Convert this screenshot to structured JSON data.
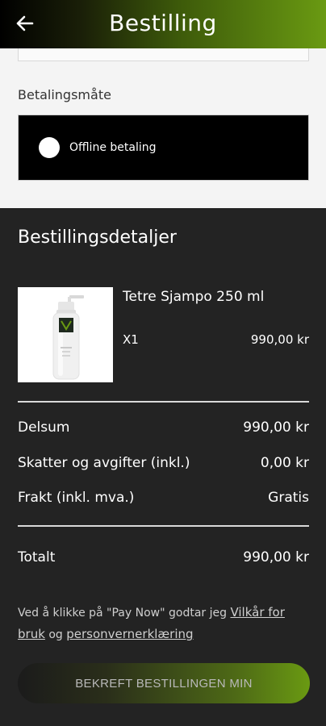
{
  "header": {
    "title": "Bestilling",
    "back_icon": "arrow-left-icon"
  },
  "payment": {
    "label": "Betalingsmåte",
    "option_label": "Offline betaling",
    "selected": true
  },
  "order": {
    "title": "Bestillingsdetaljer",
    "item": {
      "name": "Tetre Sjampo 250 ml",
      "qty": "X1",
      "price": "990,00 kr"
    },
    "subtotal": {
      "label": "Delsum",
      "value": "990,00 kr"
    },
    "taxes": {
      "label": "Skatter og avgifter (inkl.)",
      "value": "0,00 kr"
    },
    "shipping": {
      "label": "Frakt (inkl. mva.)",
      "value": "Gratis"
    },
    "total": {
      "label": "Totalt",
      "value": "990,00 kr"
    }
  },
  "terms": {
    "prefix": "Ved å klikke på \"Pay Now\" godtar jeg ",
    "link1": "Vilkår for bruk",
    "middle": " og ",
    "link2": "personvernerklæring"
  },
  "confirm_button": {
    "label": "BEKREFT BESTILLINGEN MIN"
  },
  "colors": {
    "accent": "#6a9a12",
    "background": "#232323",
    "panel": "#f4f4f4"
  }
}
